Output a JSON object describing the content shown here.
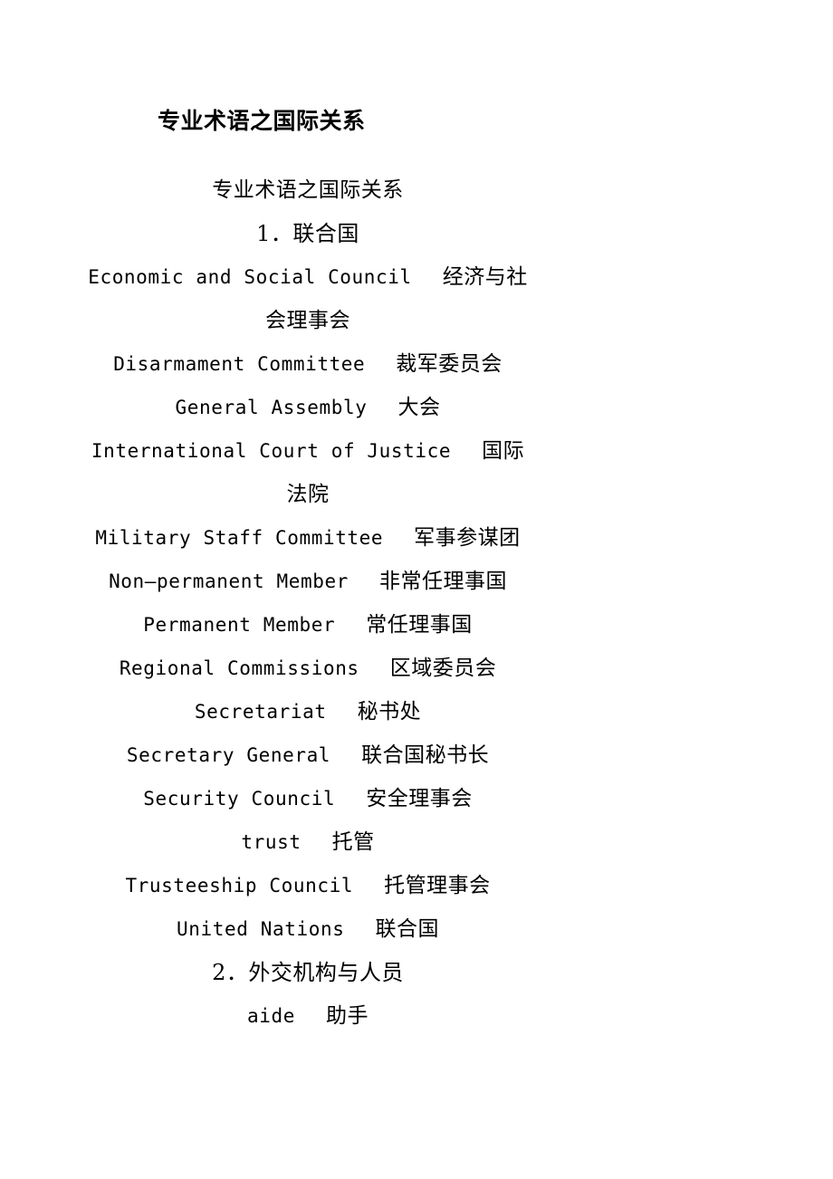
{
  "document": {
    "title": "专业术语之国际关系",
    "subtitle": "专业术语之国际关系",
    "text_color": "#000000",
    "background_color": "#ffffff"
  },
  "sections": [
    {
      "heading": "1．联合国",
      "entries": [
        {
          "term": "Economic and Social Council",
          "gloss": "经济与社",
          "gloss_cont": "会理事会"
        },
        {
          "term": "Disarmament Committee",
          "gloss": "裁军委员会",
          "gloss_cont": ""
        },
        {
          "term": "General Assembly",
          "gloss": "大会",
          "gloss_cont": ""
        },
        {
          "term": "International Court of Justice",
          "gloss": "国际",
          "gloss_cont": "法院"
        },
        {
          "term": "Military Staff Committee",
          "gloss": "军事参谋团",
          "gloss_cont": ""
        },
        {
          "term": "Non—permanent Member",
          "gloss": "非常任理事国",
          "gloss_cont": ""
        },
        {
          "term": "Permanent Member",
          "gloss": "常任理事国",
          "gloss_cont": ""
        },
        {
          "term": "Regional Commissions",
          "gloss": "区域委员会",
          "gloss_cont": ""
        },
        {
          "term": "Secretariat",
          "gloss": "秘书处",
          "gloss_cont": ""
        },
        {
          "term": "Secretary  General",
          "gloss": "联合国秘书长",
          "gloss_cont": ""
        },
        {
          "term": "Security  Council",
          "gloss": "安全理事会",
          "gloss_cont": ""
        },
        {
          "term": "trust",
          "gloss": "托管",
          "gloss_cont": ""
        },
        {
          "term": "Trusteeship  Council",
          "gloss": "托管理事会",
          "gloss_cont": ""
        },
        {
          "term": "United  Nations",
          "gloss": "联合国",
          "gloss_cont": ""
        }
      ]
    },
    {
      "heading": "2．外交机构与人员",
      "entries": [
        {
          "term": "aide",
          "gloss": "助手",
          "gloss_cont": ""
        }
      ]
    }
  ]
}
